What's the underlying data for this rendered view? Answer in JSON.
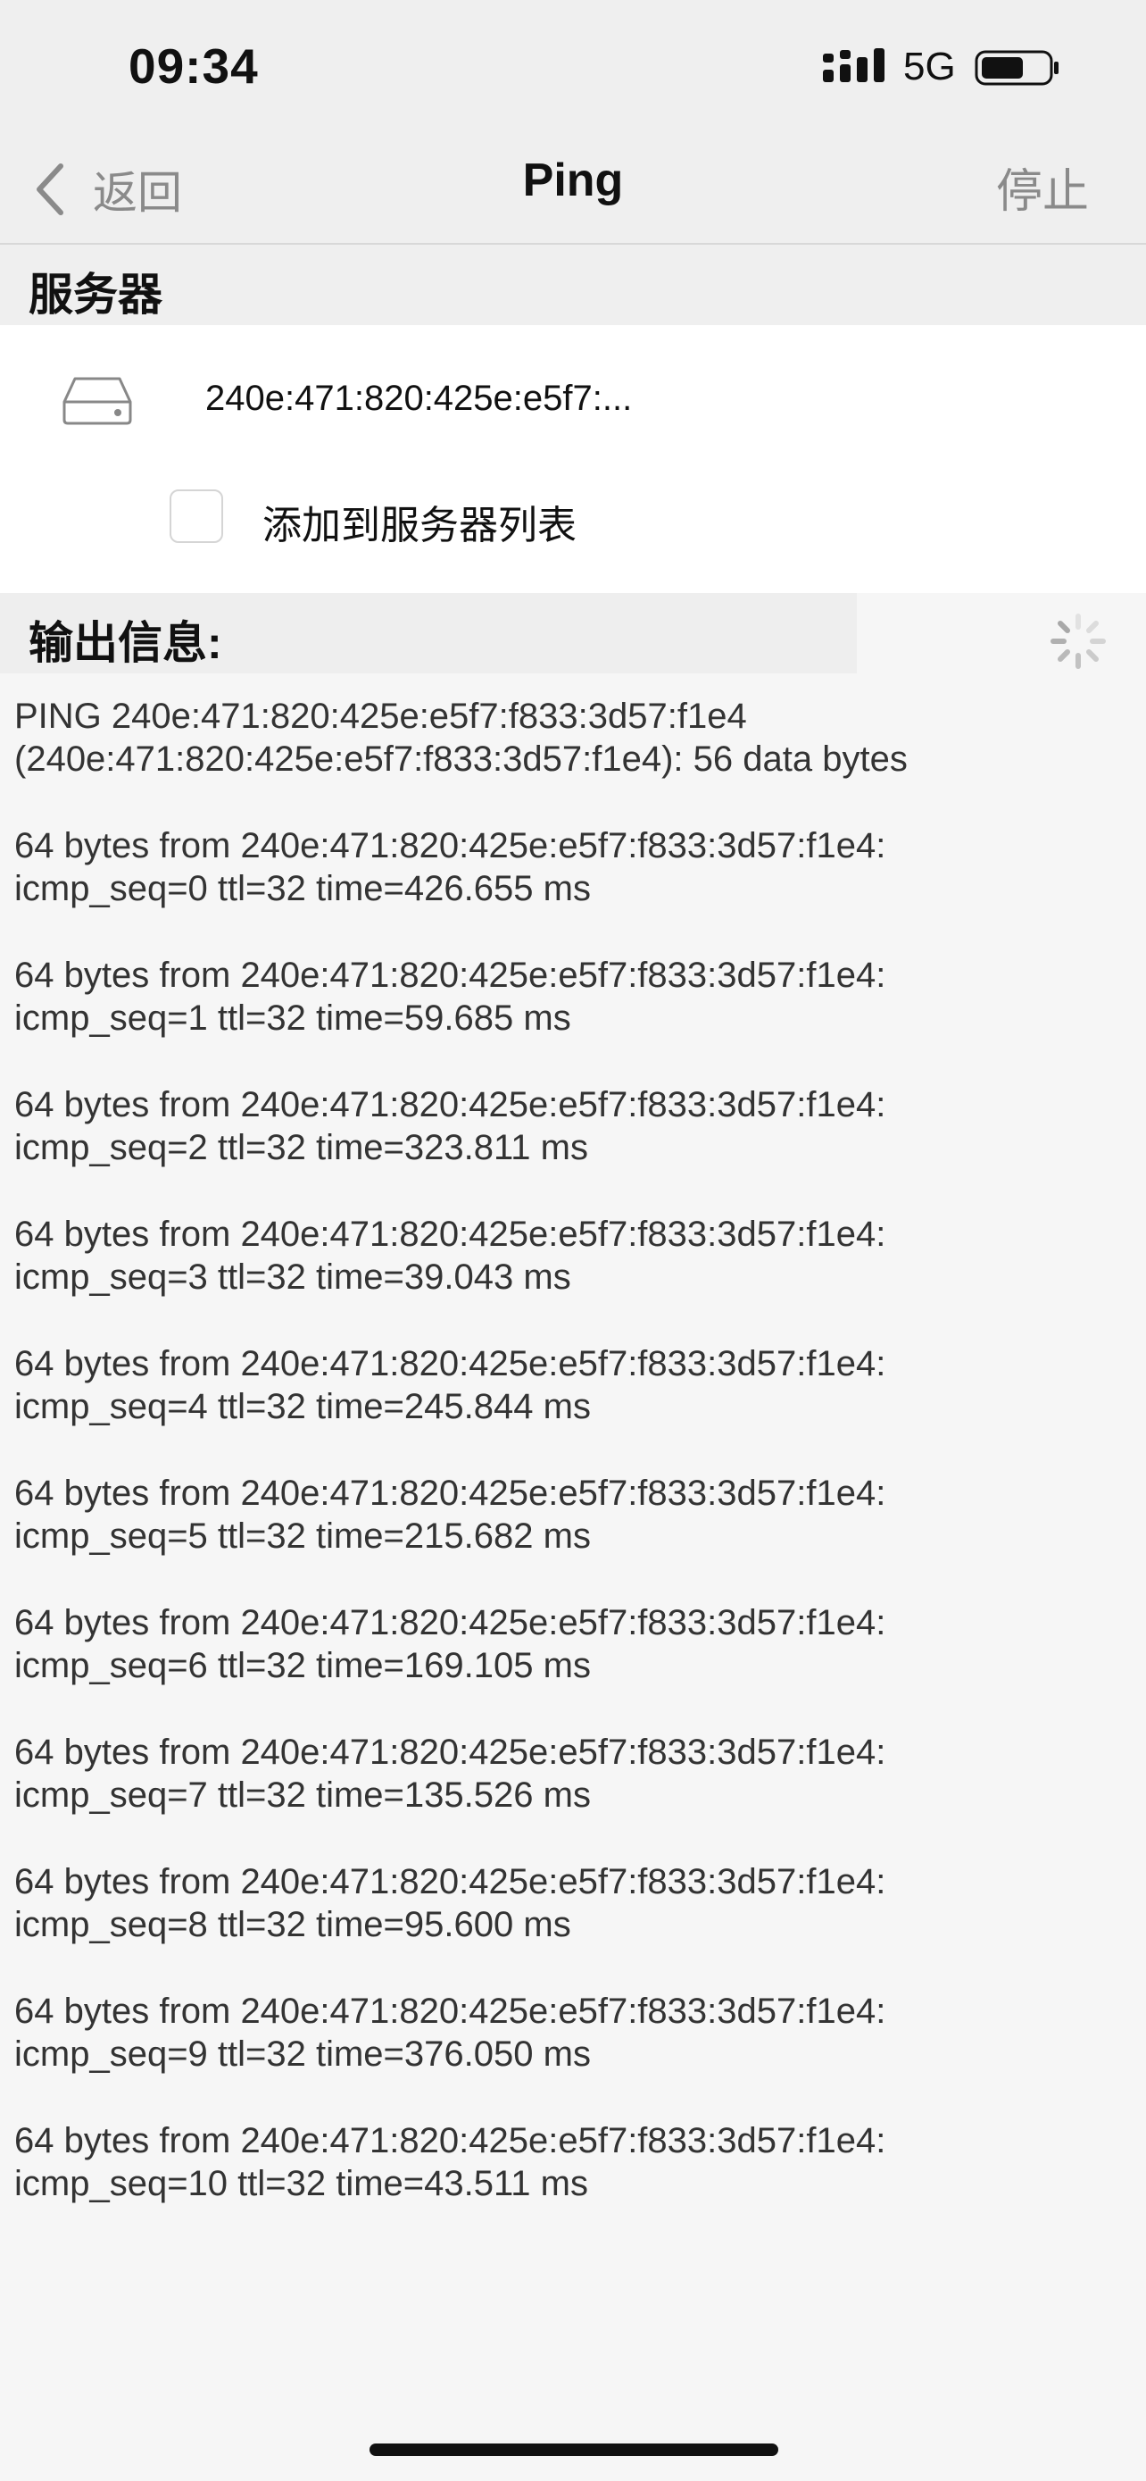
{
  "status_bar": {
    "time": "09:34",
    "network": "5G",
    "icons": [
      "signal-icon",
      "battery-icon"
    ]
  },
  "nav": {
    "back_label": "返回",
    "title": "Ping",
    "stop_label": "停止",
    "icons": [
      "chevron-left-icon"
    ]
  },
  "server": {
    "section_label": "服务器",
    "address": "240e:471:820:425e:e5f7:...",
    "add_to_list_label": "添加到服务器列表",
    "icons": [
      "drive-icon"
    ]
  },
  "output": {
    "section_label": "输出信息:",
    "icons": [
      "spinner-icon"
    ],
    "lines": [
      "PING 240e:471:820:425e:e5f7:f833:3d57:f1e4\n(240e:471:820:425e:e5f7:f833:3d57:f1e4): 56 data bytes",
      "64 bytes from 240e:471:820:425e:e5f7:f833:3d57:f1e4:\nicmp_seq=0 ttl=32 time=426.655 ms",
      "64 bytes from 240e:471:820:425e:e5f7:f833:3d57:f1e4:\nicmp_seq=1 ttl=32 time=59.685 ms",
      "64 bytes from 240e:471:820:425e:e5f7:f833:3d57:f1e4:\nicmp_seq=2 ttl=32 time=323.811 ms",
      "64 bytes from 240e:471:820:425e:e5f7:f833:3d57:f1e4:\nicmp_seq=3 ttl=32 time=39.043 ms",
      "64 bytes from 240e:471:820:425e:e5f7:f833:3d57:f1e4:\nicmp_seq=4 ttl=32 time=245.844 ms",
      "64 bytes from 240e:471:820:425e:e5f7:f833:3d57:f1e4:\nicmp_seq=5 ttl=32 time=215.682 ms",
      "64 bytes from 240e:471:820:425e:e5f7:f833:3d57:f1e4:\nicmp_seq=6 ttl=32 time=169.105 ms",
      "64 bytes from 240e:471:820:425e:e5f7:f833:3d57:f1e4:\nicmp_seq=7 ttl=32 time=135.526 ms",
      "64 bytes from 240e:471:820:425e:e5f7:f833:3d57:f1e4:\nicmp_seq=8 ttl=32 time=95.600 ms",
      "64 bytes from 240e:471:820:425e:e5f7:f833:3d57:f1e4:\nicmp_seq=9 ttl=32 time=376.050 ms",
      "64 bytes from 240e:471:820:425e:e5f7:f833:3d57:f1e4:\nicmp_seq=10 ttl=32 time=43.511 ms"
    ]
  },
  "colors": {
    "background": "#f6f6f6",
    "header_bg": "#efefef",
    "panel_bg": "#ffffff",
    "muted_text": "#8a8a8a",
    "text": "#111111"
  }
}
